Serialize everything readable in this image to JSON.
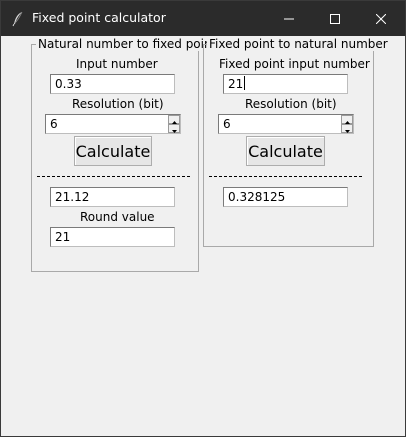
{
  "window": {
    "title": "Fixed point calculator",
    "icon": "feather-icon"
  },
  "left_panel": {
    "legend": "Natural number to fixed point",
    "input_label": "Input number",
    "input_value": "0.33",
    "resolution_label": "Resolution (bit)",
    "resolution_value": "6",
    "calculate_label": "Calculate",
    "separator": "-----------------------------------",
    "result_value": "21.12",
    "round_label": "Round value",
    "round_value": "21"
  },
  "right_panel": {
    "legend": "Fixed point to natural number",
    "input_label": "Fixed point input number",
    "input_value": "21",
    "resolution_label": "Resolution (bit)",
    "resolution_value": "6",
    "calculate_label": "Calculate",
    "separator": "-----------------------------------",
    "result_value": "0.328125"
  },
  "colors": {
    "titlebar": "#2b2b2b",
    "client": "#f0f0f0"
  }
}
